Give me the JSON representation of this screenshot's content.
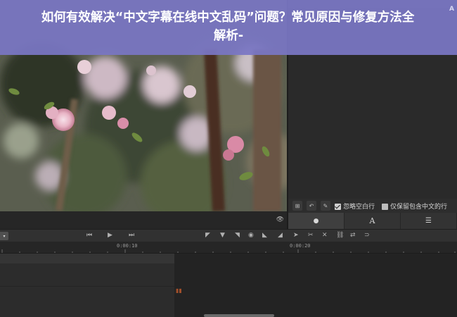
{
  "banner": {
    "line1": "如何有效解决“中文字幕在线中文乱码”问题？常见原因与修复方法全",
    "line2": "解析-",
    "corner": "A"
  },
  "subtitle_options": {
    "ignore_blank_lines": "忽略空白行",
    "ignore_blank_checked": true,
    "keep_chinese_lines": "仅保留包含中文的行",
    "keep_chinese_checked": false
  },
  "right_tabs": [
    {
      "icon": "speech-bubble-icon",
      "glyph": "💬",
      "active": true
    },
    {
      "icon": "text-icon",
      "glyph": "A",
      "active": false
    },
    {
      "icon": "list-icon",
      "glyph": "☰",
      "active": false
    }
  ],
  "timeline": {
    "timecode_0": "0:00:10",
    "timecode_1": "0:00:20"
  },
  "colors": {
    "banner": "#7a76c4",
    "panel": "#2b2b2b",
    "accent_marker": "#a14f2b"
  }
}
